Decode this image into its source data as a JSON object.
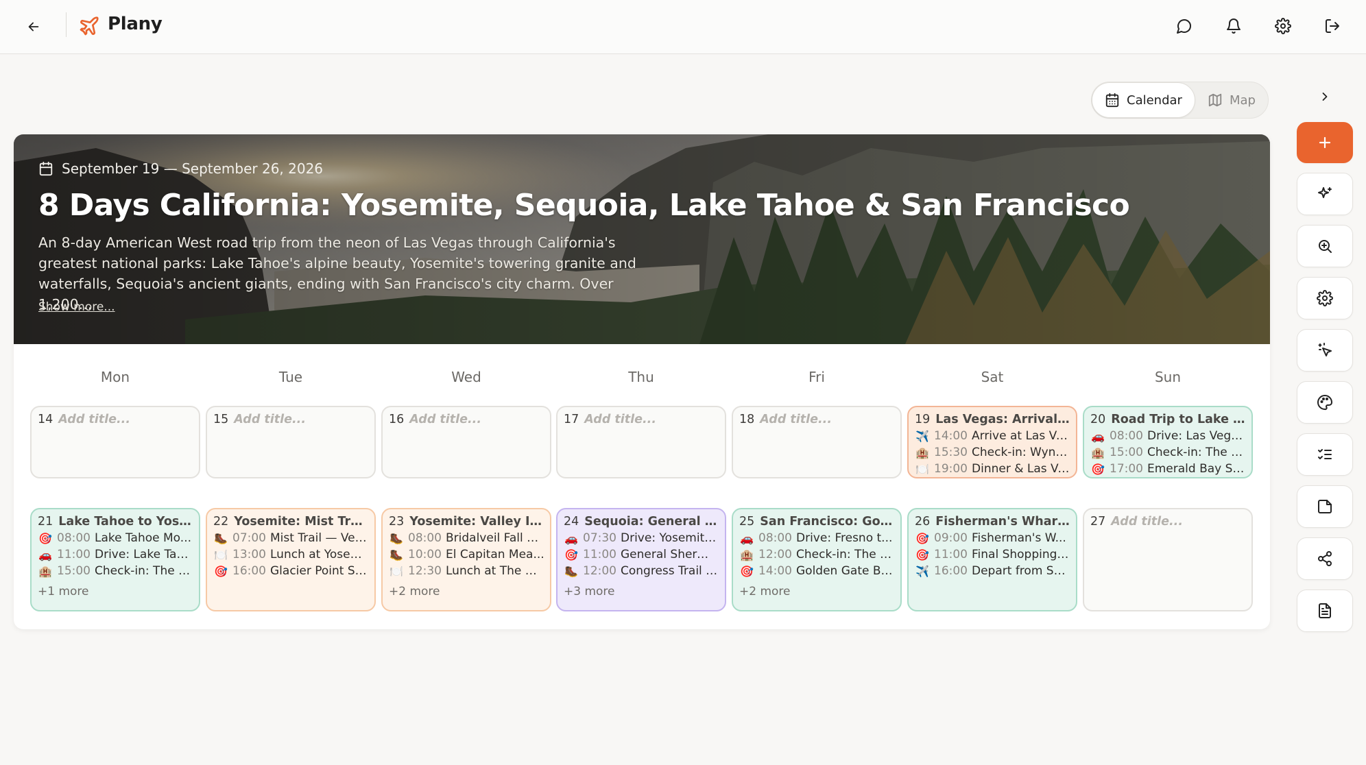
{
  "app": {
    "name": "Plany"
  },
  "view_toggle": {
    "calendar": "Calendar",
    "map": "Map"
  },
  "trip": {
    "dates": "September 19 — September 26, 2026",
    "title": "8 Days California: Yosemite, Sequoia, Lake Tahoe & San Francisco",
    "description": "An 8-day American West road trip from the neon of Las Vegas through California's greatest national parks: Lake Tahoe's alpine beauty, Yosemite's towering granite and waterfalls, Sequoia's ancient giants, ending with San Francisco's city charm. Over 1,200...",
    "show_more": "Show more..."
  },
  "weekdays": [
    "Mon",
    "Tue",
    "Wed",
    "Thu",
    "Fri",
    "Sat",
    "Sun"
  ],
  "placeholder": "Add title...",
  "week1": [
    {
      "num": "14",
      "title": ""
    },
    {
      "num": "15",
      "title": ""
    },
    {
      "num": "16",
      "title": ""
    },
    {
      "num": "17",
      "title": ""
    },
    {
      "num": "18",
      "title": ""
    },
    {
      "num": "19",
      "title": "Las Vegas: Arrival & ...",
      "events": [
        {
          "icon": "airplane-icon",
          "time": "14:00",
          "name": "Arrive at Las Ve..."
        },
        {
          "icon": "hotel-icon",
          "time": "15:30",
          "name": "Check-in: Wynn..."
        },
        {
          "icon": "dining-icon",
          "time": "19:00",
          "name": "Dinner & Las Ve..."
        }
      ]
    },
    {
      "num": "20",
      "title": "Road Trip to Lake Ta...",
      "events": [
        {
          "icon": "car-icon",
          "time": "08:00",
          "name": "Drive: Las Vega..."
        },
        {
          "icon": "hotel-icon",
          "time": "15:00",
          "name": "Check-in: The R..."
        },
        {
          "icon": "target-icon",
          "time": "17:00",
          "name": "Emerald Bay Su..."
        }
      ]
    }
  ],
  "week2": [
    {
      "num": "21",
      "title": "Lake Tahoe to Yosem...",
      "events": [
        {
          "icon": "target-icon",
          "time": "08:00",
          "name": "Lake Tahoe Mo..."
        },
        {
          "icon": "car-icon",
          "time": "11:00",
          "name": "Drive: Lake Taho..."
        },
        {
          "icon": "hotel-icon",
          "time": "15:00",
          "name": "Check-in: The A..."
        }
      ],
      "more": "+1 more"
    },
    {
      "num": "22",
      "title": "Yosemite: Mist Trail ...",
      "events": [
        {
          "icon": "boot-icon",
          "time": "07:00",
          "name": "Mist Trail — Ver..."
        },
        {
          "icon": "dining-icon",
          "time": "13:00",
          "name": "Lunch at Yosem..."
        },
        {
          "icon": "target-icon",
          "time": "16:00",
          "name": "Glacier Point Su..."
        }
      ]
    },
    {
      "num": "23",
      "title": "Yosemite: Valley Ico...",
      "events": [
        {
          "icon": "boot-icon",
          "time": "08:00",
          "name": "Bridalveil Fall M..."
        },
        {
          "icon": "boot-icon",
          "time": "10:00",
          "name": "El Capitan Mea..."
        },
        {
          "icon": "dining-icon",
          "time": "12:30",
          "name": "Lunch at The Ah..."
        }
      ],
      "more": "+2 more"
    },
    {
      "num": "24",
      "title": "Sequoia: General Sh...",
      "events": [
        {
          "icon": "car-icon",
          "time": "07:30",
          "name": "Drive: Yosemite..."
        },
        {
          "icon": "target-icon",
          "time": "11:00",
          "name": "General Sherma..."
        },
        {
          "icon": "boot-icon",
          "time": "12:00",
          "name": "Congress Trail L..."
        }
      ],
      "more": "+3 more"
    },
    {
      "num": "25",
      "title": "San Francisco: Gold...",
      "events": [
        {
          "icon": "car-icon",
          "time": "08:00",
          "name": "Drive: Fresno t..."
        },
        {
          "icon": "hotel-icon",
          "time": "12:00",
          "name": "Check-in: The S..."
        },
        {
          "icon": "target-icon",
          "time": "14:00",
          "name": "Golden Gate Bri..."
        }
      ],
      "more": "+2 more"
    },
    {
      "num": "26",
      "title": "Fisherman's Wharf ...",
      "events": [
        {
          "icon": "target-icon",
          "time": "09:00",
          "name": "Fisherman's W..."
        },
        {
          "icon": "target-icon",
          "time": "11:00",
          "name": "Final Shopping ..."
        },
        {
          "icon": "airplane-icon",
          "time": "16:00",
          "name": "Depart from Sa..."
        }
      ]
    },
    {
      "num": "27",
      "title": ""
    }
  ],
  "colors": {
    "accent": "#e9642e",
    "peach": "#fef3e9",
    "mint": "#e6f5ef",
    "violet": "#eee9fb"
  }
}
